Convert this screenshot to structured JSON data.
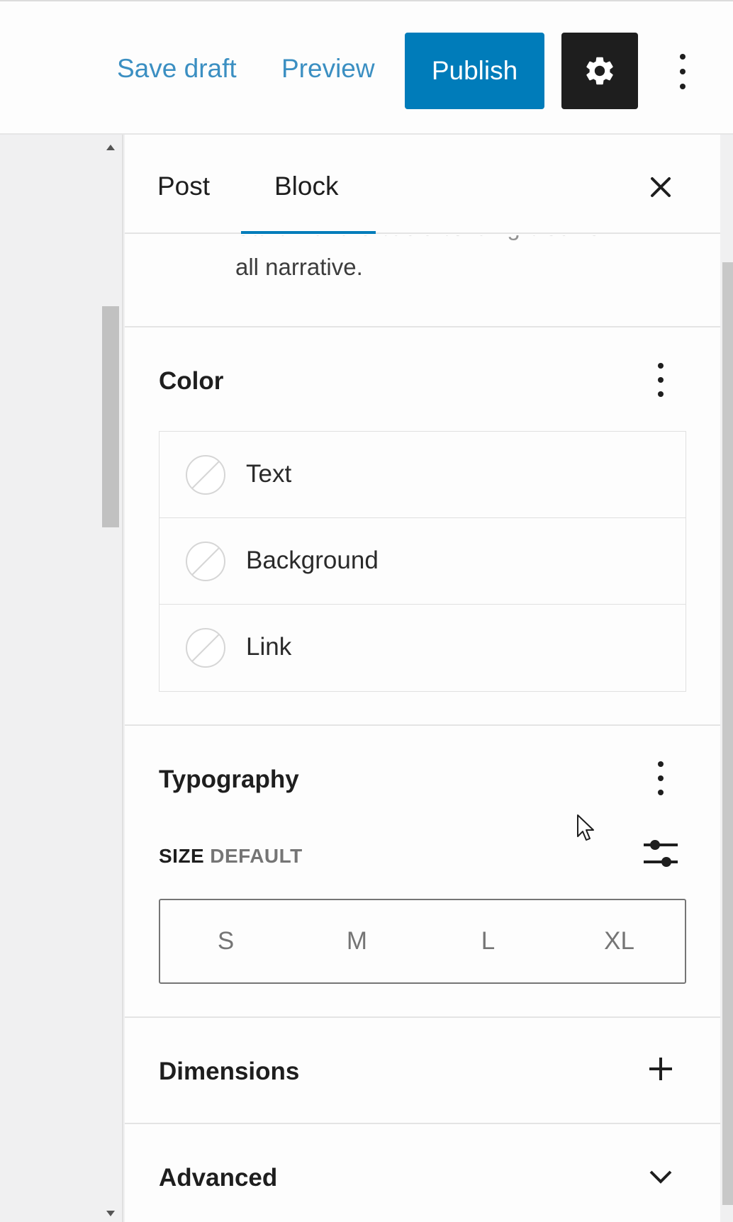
{
  "toolbar": {
    "save_draft": "Save draft",
    "preview": "Preview",
    "publish": "Publish",
    "settings_icon": "gear-icon",
    "more_icon": "vertical-ellipsis-icon"
  },
  "sidebar": {
    "tabs": [
      {
        "label": "Post",
        "active": false
      },
      {
        "label": "Block",
        "active": true
      }
    ],
    "close_icon": "close-icon",
    "description_partial": "Start with the basic building block of",
    "description_tail": "all narrative."
  },
  "color_panel": {
    "title": "Color",
    "items": [
      {
        "label": "Text"
      },
      {
        "label": "Background"
      },
      {
        "label": "Link"
      }
    ]
  },
  "typography_panel": {
    "title": "Typography",
    "size_label": "SIZE",
    "size_value": "DEFAULT",
    "size_options": [
      "S",
      "M",
      "L",
      "XL"
    ]
  },
  "dimensions_panel": {
    "title": "Dimensions"
  },
  "advanced_panel": {
    "title": "Advanced"
  },
  "colors": {
    "accent": "#007cba",
    "link": "#3b8fc2",
    "dark": "#1e1e1e"
  }
}
